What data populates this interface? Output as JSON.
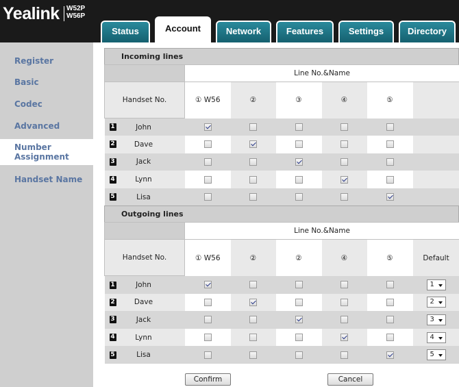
{
  "brand": {
    "logo": "Yealink",
    "model_line1": "W52P",
    "model_line2": "W56P"
  },
  "tabs": [
    {
      "id": "status",
      "label": "Status"
    },
    {
      "id": "account",
      "label": "Account",
      "active": true
    },
    {
      "id": "network",
      "label": "Network"
    },
    {
      "id": "features",
      "label": "Features"
    },
    {
      "id": "settings",
      "label": "Settings"
    },
    {
      "id": "directory",
      "label": "Directory"
    }
  ],
  "sidebar": {
    "items": [
      {
        "label": "Register"
      },
      {
        "label": "Basic"
      },
      {
        "label": "Codec"
      },
      {
        "label": "Advanced"
      },
      {
        "label": "Number Assignment",
        "active": true
      },
      {
        "label": "Handset Name"
      }
    ]
  },
  "incoming": {
    "title": "Incoming lines",
    "line_header": "Line No.&Name",
    "handset_header": "Handset No.",
    "lines": [
      "① W56",
      "②",
      "③",
      "④",
      "⑤"
    ],
    "rows": [
      {
        "num": "1",
        "name": "John",
        "checks": [
          true,
          false,
          false,
          false,
          false
        ]
      },
      {
        "num": "2",
        "name": "Dave",
        "checks": [
          false,
          true,
          false,
          false,
          false
        ]
      },
      {
        "num": "3",
        "name": "Jack",
        "checks": [
          false,
          false,
          true,
          false,
          false
        ]
      },
      {
        "num": "4",
        "name": "Lynn",
        "checks": [
          false,
          false,
          false,
          true,
          false
        ]
      },
      {
        "num": "5",
        "name": "Lisa",
        "checks": [
          false,
          false,
          false,
          false,
          true
        ]
      }
    ]
  },
  "outgoing": {
    "title": "Outgoing lines",
    "line_header": "Line No.&Name",
    "handset_header": "Handset No.",
    "lines": [
      "① W56",
      "②",
      "②",
      "④",
      "⑤"
    ],
    "default_header": "Default",
    "rows": [
      {
        "num": "1",
        "name": "John",
        "checks": [
          true,
          false,
          false,
          false,
          false
        ],
        "default": "1"
      },
      {
        "num": "2",
        "name": "Dave",
        "checks": [
          false,
          true,
          false,
          false,
          false
        ],
        "default": "2"
      },
      {
        "num": "3",
        "name": "Jack",
        "checks": [
          false,
          false,
          true,
          false,
          false
        ],
        "default": "3"
      },
      {
        "num": "4",
        "name": "Lynn",
        "checks": [
          false,
          false,
          false,
          true,
          false
        ],
        "default": "4"
      },
      {
        "num": "5",
        "name": "Lisa",
        "checks": [
          false,
          false,
          false,
          false,
          true
        ],
        "default": "5"
      }
    ]
  },
  "buttons": {
    "confirm": "Confirm",
    "cancel": "Cancel"
  },
  "colors": {
    "header_bg": "#1a1a1a",
    "tab_teal": "#1f7a8c",
    "sidebar_bg": "#cfcfcf",
    "link_blue": "#5a76a2"
  }
}
